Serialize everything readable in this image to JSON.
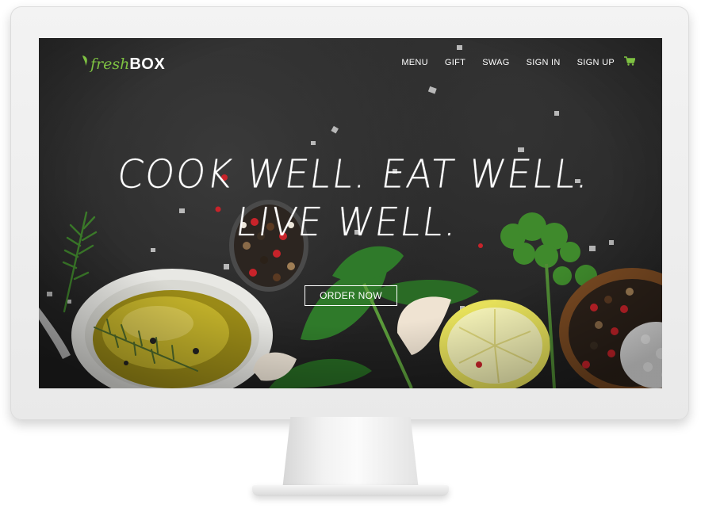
{
  "brand": {
    "fresh": "fresh",
    "box": "BOX",
    "accent_color": "#7ec242"
  },
  "nav": {
    "items": [
      {
        "label": "MENU"
      },
      {
        "label": "GIFT"
      },
      {
        "label": "SWAG"
      },
      {
        "label": "SIGN IN"
      },
      {
        "label": "SIGN UP"
      }
    ],
    "cart_icon": "shopping-cart-icon",
    "cart_color": "#7ec242"
  },
  "hero": {
    "headline": "COOK WELL. EAT WELL. LIVE WELL.",
    "cta_label": "ORDER NOW"
  },
  "background": {
    "color": "#2a2a2a",
    "items": [
      "olive-oil-bowl",
      "rosemary",
      "peppercorn-spoon",
      "basil",
      "garlic",
      "lemon-slice",
      "parsley",
      "peppercorn-bowl",
      "sea-salt"
    ]
  }
}
